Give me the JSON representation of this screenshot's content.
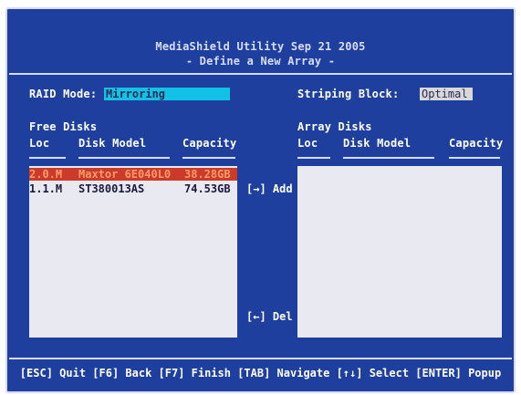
{
  "header": {
    "line1": "MediaShield Utility  Sep 21 2005",
    "line2": "- Define a New Array -"
  },
  "raid_mode": {
    "label": "RAID Mode:",
    "value": "Mirroring"
  },
  "striping_block": {
    "label": "Striping Block:",
    "value": "Optimal"
  },
  "free_disks": {
    "title": "Free Disks",
    "columns": [
      "Loc",
      "Disk Model",
      "Capacity"
    ],
    "rows": [
      {
        "loc": "2.0.M",
        "model": "Maxtor 6E040L0",
        "capacity": "38.28GB",
        "selected": true
      },
      {
        "loc": "1.1.M",
        "model": "ST380013AS",
        "capacity": "74.53GB",
        "selected": false
      }
    ]
  },
  "array_disks": {
    "title": "Array Disks",
    "columns": [
      "Loc",
      "Disk Model",
      "Capacity"
    ]
  },
  "buttons": {
    "add": "[→] Add",
    "del": "[←] Del"
  },
  "footer": "[ESC] Quit [F6] Back [F7] Finish [TAB] Navigate [↑↓] Select [ENTER] Popup",
  "colors": {
    "background": "#1f3f9e",
    "mode_field": "#11c2e6",
    "selected_row": "#cc3a2a",
    "list_bg": "#e9e9f2"
  }
}
